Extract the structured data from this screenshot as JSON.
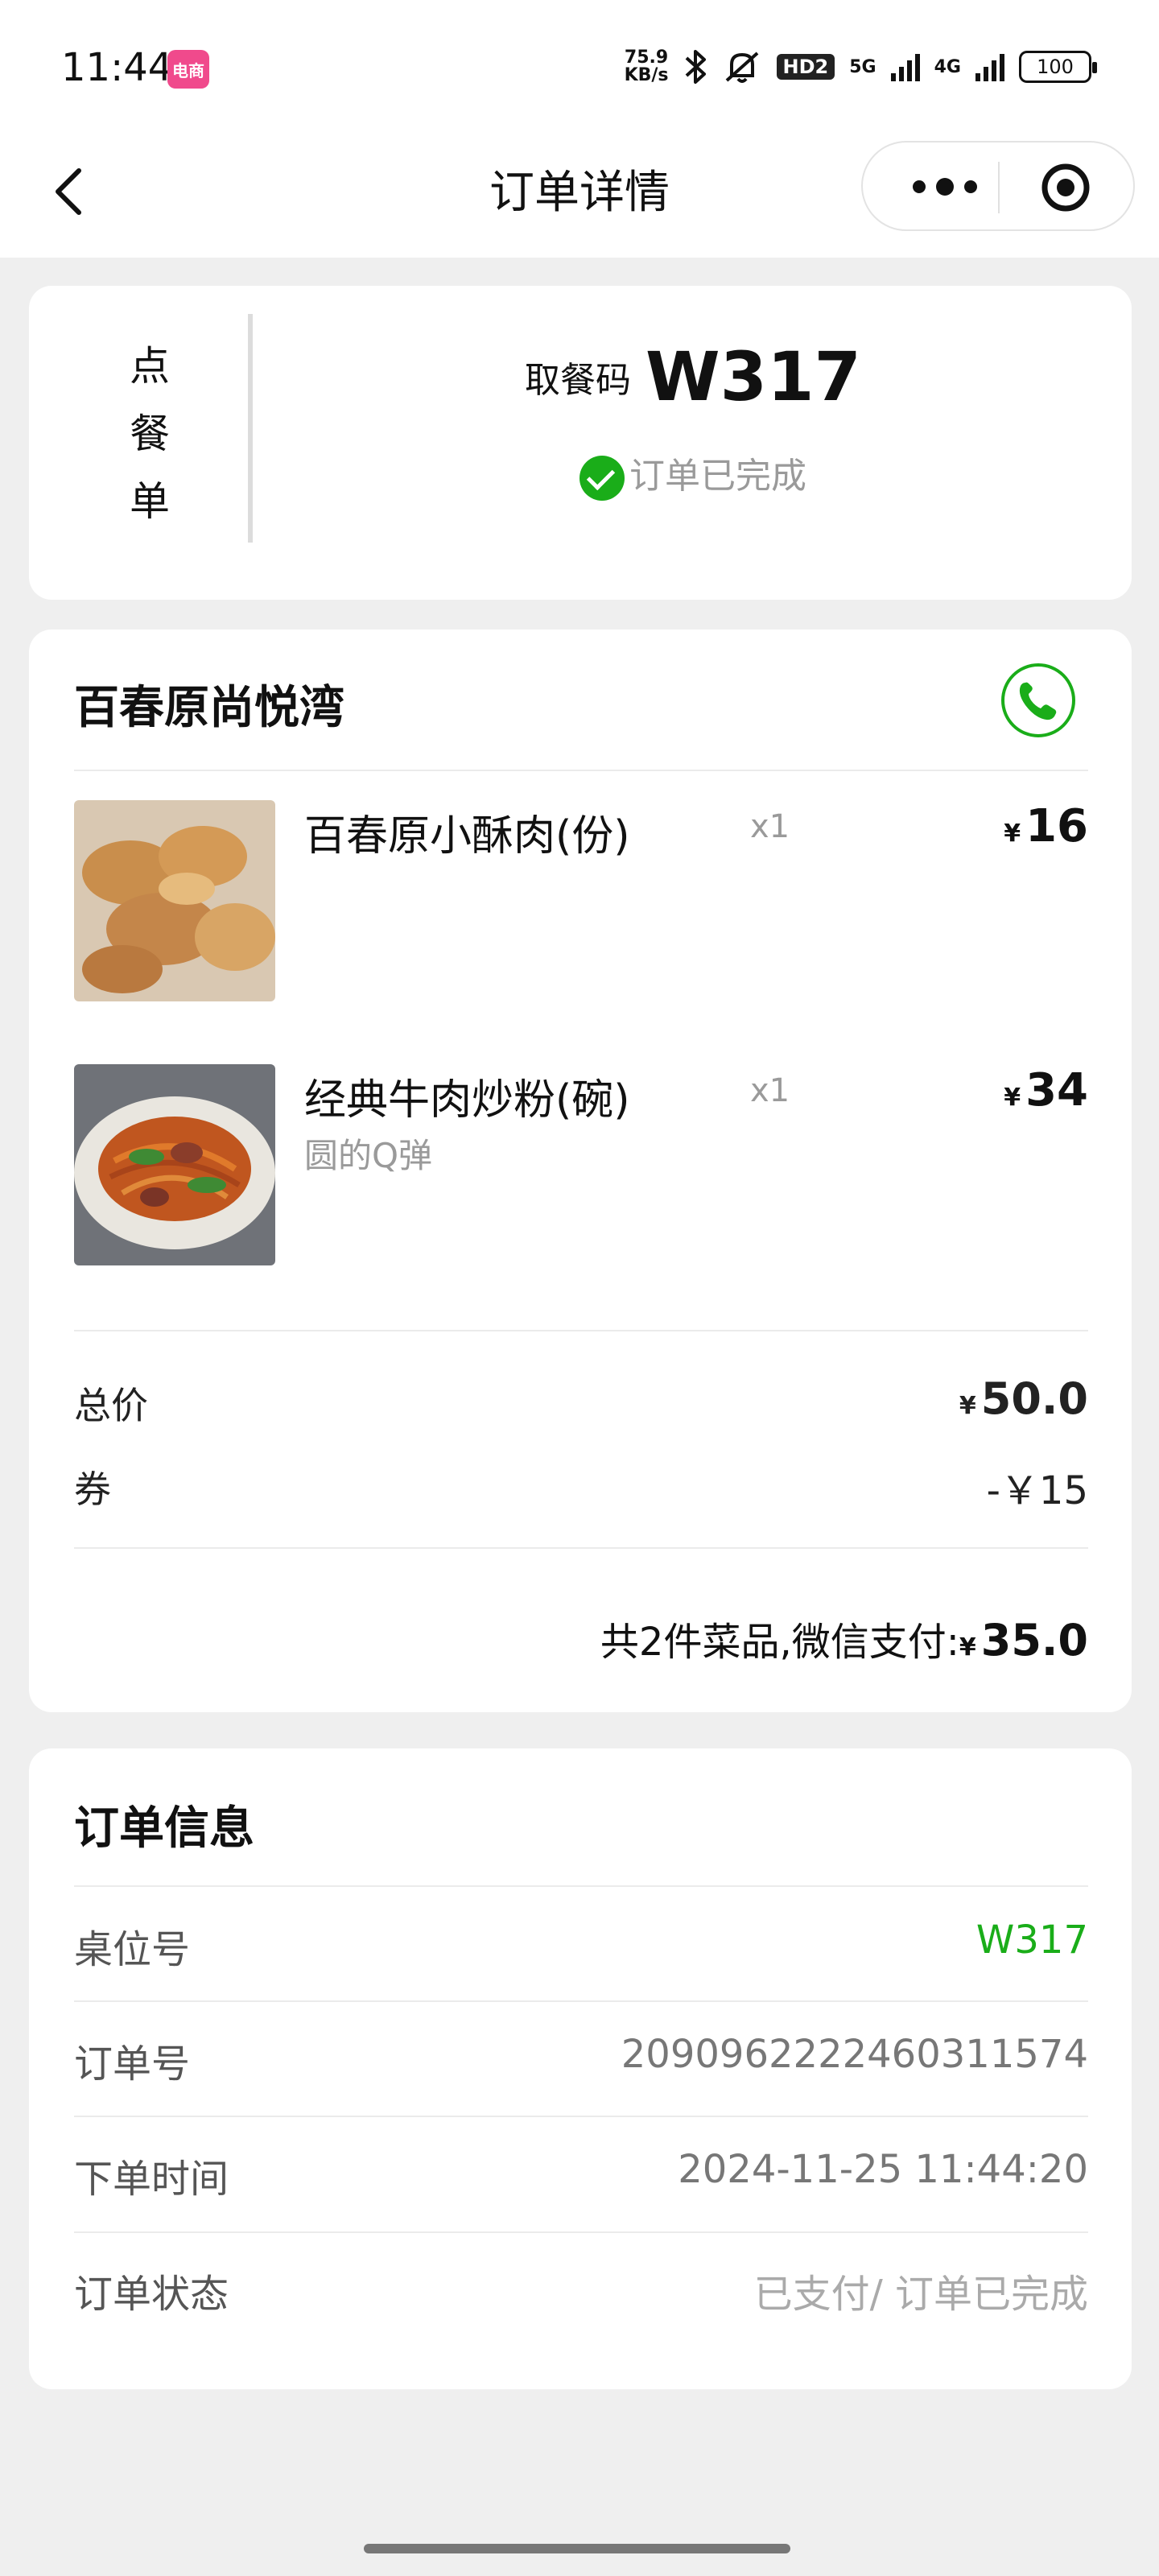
{
  "status_bar": {
    "time": "11:44",
    "app_badge": "电商",
    "net_speed_value": "75.9",
    "net_speed_unit": "KB/s",
    "hd_label": "HD2",
    "net1": "5G",
    "net2": "4G",
    "battery": "100"
  },
  "nav": {
    "title": "订单详情",
    "back_icon": "chevron-left-icon",
    "more_icon": "more-dots-icon",
    "close_icon": "target-circle-icon"
  },
  "pickup": {
    "side_label": [
      "点",
      "餐",
      "单"
    ],
    "code_label": "取餐码",
    "code": "W317",
    "status": "订单已完成"
  },
  "shop": {
    "name": "百春原尚悦湾",
    "phone_icon": "phone-icon",
    "items": [
      {
        "name": "百春原小酥肉(份)",
        "desc": "",
        "qty": "x1",
        "currency": "¥",
        "price": "16"
      },
      {
        "name": "经典牛肉炒粉(碗)",
        "desc": "圆的Q弹",
        "qty": "x1",
        "currency": "¥",
        "price": "34"
      }
    ],
    "total_label": "总价",
    "total_currency": "¥",
    "total_value": "50.0",
    "coupon_label": "券",
    "coupon_value": "-￥15",
    "pay_summary_prefix": "共2件菜品,微信支付:",
    "pay_currency": "¥",
    "pay_value": "35.0"
  },
  "order_info": {
    "title": "订单信息",
    "rows": [
      {
        "label": "桌位号",
        "value": "W317"
      },
      {
        "label": "订单号",
        "value": "2090962222460311574"
      },
      {
        "label": "下单时间",
        "value": "2024-11-25 11:44:20"
      },
      {
        "label": "订单状态",
        "value": "已支付/ 订单已完成"
      }
    ]
  },
  "colors": {
    "accent_green": "#1aad19",
    "background": "#efefef"
  }
}
